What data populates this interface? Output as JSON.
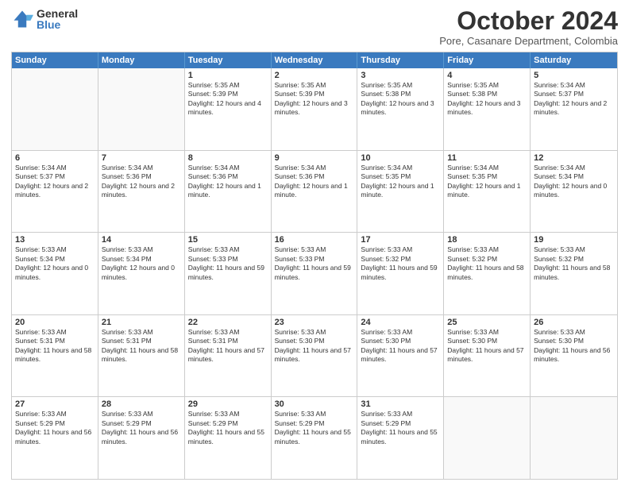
{
  "logo": {
    "general": "General",
    "blue": "Blue"
  },
  "header": {
    "month": "October 2024",
    "location": "Pore, Casanare Department, Colombia"
  },
  "days": [
    "Sunday",
    "Monday",
    "Tuesday",
    "Wednesday",
    "Thursday",
    "Friday",
    "Saturday"
  ],
  "rows": [
    [
      {
        "day": "",
        "empty": true
      },
      {
        "day": "",
        "empty": true
      },
      {
        "day": "1",
        "sunrise": "Sunrise: 5:35 AM",
        "sunset": "Sunset: 5:39 PM",
        "daylight": "Daylight: 12 hours and 4 minutes."
      },
      {
        "day": "2",
        "sunrise": "Sunrise: 5:35 AM",
        "sunset": "Sunset: 5:39 PM",
        "daylight": "Daylight: 12 hours and 3 minutes."
      },
      {
        "day": "3",
        "sunrise": "Sunrise: 5:35 AM",
        "sunset": "Sunset: 5:38 PM",
        "daylight": "Daylight: 12 hours and 3 minutes."
      },
      {
        "day": "4",
        "sunrise": "Sunrise: 5:35 AM",
        "sunset": "Sunset: 5:38 PM",
        "daylight": "Daylight: 12 hours and 3 minutes."
      },
      {
        "day": "5",
        "sunrise": "Sunrise: 5:34 AM",
        "sunset": "Sunset: 5:37 PM",
        "daylight": "Daylight: 12 hours and 2 minutes."
      }
    ],
    [
      {
        "day": "6",
        "sunrise": "Sunrise: 5:34 AM",
        "sunset": "Sunset: 5:37 PM",
        "daylight": "Daylight: 12 hours and 2 minutes."
      },
      {
        "day": "7",
        "sunrise": "Sunrise: 5:34 AM",
        "sunset": "Sunset: 5:36 PM",
        "daylight": "Daylight: 12 hours and 2 minutes."
      },
      {
        "day": "8",
        "sunrise": "Sunrise: 5:34 AM",
        "sunset": "Sunset: 5:36 PM",
        "daylight": "Daylight: 12 hours and 1 minute."
      },
      {
        "day": "9",
        "sunrise": "Sunrise: 5:34 AM",
        "sunset": "Sunset: 5:36 PM",
        "daylight": "Daylight: 12 hours and 1 minute."
      },
      {
        "day": "10",
        "sunrise": "Sunrise: 5:34 AM",
        "sunset": "Sunset: 5:35 PM",
        "daylight": "Daylight: 12 hours and 1 minute."
      },
      {
        "day": "11",
        "sunrise": "Sunrise: 5:34 AM",
        "sunset": "Sunset: 5:35 PM",
        "daylight": "Daylight: 12 hours and 1 minute."
      },
      {
        "day": "12",
        "sunrise": "Sunrise: 5:34 AM",
        "sunset": "Sunset: 5:34 PM",
        "daylight": "Daylight: 12 hours and 0 minutes."
      }
    ],
    [
      {
        "day": "13",
        "sunrise": "Sunrise: 5:33 AM",
        "sunset": "Sunset: 5:34 PM",
        "daylight": "Daylight: 12 hours and 0 minutes."
      },
      {
        "day": "14",
        "sunrise": "Sunrise: 5:33 AM",
        "sunset": "Sunset: 5:34 PM",
        "daylight": "Daylight: 12 hours and 0 minutes."
      },
      {
        "day": "15",
        "sunrise": "Sunrise: 5:33 AM",
        "sunset": "Sunset: 5:33 PM",
        "daylight": "Daylight: 11 hours and 59 minutes."
      },
      {
        "day": "16",
        "sunrise": "Sunrise: 5:33 AM",
        "sunset": "Sunset: 5:33 PM",
        "daylight": "Daylight: 11 hours and 59 minutes."
      },
      {
        "day": "17",
        "sunrise": "Sunrise: 5:33 AM",
        "sunset": "Sunset: 5:32 PM",
        "daylight": "Daylight: 11 hours and 59 minutes."
      },
      {
        "day": "18",
        "sunrise": "Sunrise: 5:33 AM",
        "sunset": "Sunset: 5:32 PM",
        "daylight": "Daylight: 11 hours and 58 minutes."
      },
      {
        "day": "19",
        "sunrise": "Sunrise: 5:33 AM",
        "sunset": "Sunset: 5:32 PM",
        "daylight": "Daylight: 11 hours and 58 minutes."
      }
    ],
    [
      {
        "day": "20",
        "sunrise": "Sunrise: 5:33 AM",
        "sunset": "Sunset: 5:31 PM",
        "daylight": "Daylight: 11 hours and 58 minutes."
      },
      {
        "day": "21",
        "sunrise": "Sunrise: 5:33 AM",
        "sunset": "Sunset: 5:31 PM",
        "daylight": "Daylight: 11 hours and 58 minutes."
      },
      {
        "day": "22",
        "sunrise": "Sunrise: 5:33 AM",
        "sunset": "Sunset: 5:31 PM",
        "daylight": "Daylight: 11 hours and 57 minutes."
      },
      {
        "day": "23",
        "sunrise": "Sunrise: 5:33 AM",
        "sunset": "Sunset: 5:30 PM",
        "daylight": "Daylight: 11 hours and 57 minutes."
      },
      {
        "day": "24",
        "sunrise": "Sunrise: 5:33 AM",
        "sunset": "Sunset: 5:30 PM",
        "daylight": "Daylight: 11 hours and 57 minutes."
      },
      {
        "day": "25",
        "sunrise": "Sunrise: 5:33 AM",
        "sunset": "Sunset: 5:30 PM",
        "daylight": "Daylight: 11 hours and 57 minutes."
      },
      {
        "day": "26",
        "sunrise": "Sunrise: 5:33 AM",
        "sunset": "Sunset: 5:30 PM",
        "daylight": "Daylight: 11 hours and 56 minutes."
      }
    ],
    [
      {
        "day": "27",
        "sunrise": "Sunrise: 5:33 AM",
        "sunset": "Sunset: 5:29 PM",
        "daylight": "Daylight: 11 hours and 56 minutes."
      },
      {
        "day": "28",
        "sunrise": "Sunrise: 5:33 AM",
        "sunset": "Sunset: 5:29 PM",
        "daylight": "Daylight: 11 hours and 56 minutes."
      },
      {
        "day": "29",
        "sunrise": "Sunrise: 5:33 AM",
        "sunset": "Sunset: 5:29 PM",
        "daylight": "Daylight: 11 hours and 55 minutes."
      },
      {
        "day": "30",
        "sunrise": "Sunrise: 5:33 AM",
        "sunset": "Sunset: 5:29 PM",
        "daylight": "Daylight: 11 hours and 55 minutes."
      },
      {
        "day": "31",
        "sunrise": "Sunrise: 5:33 AM",
        "sunset": "Sunset: 5:29 PM",
        "daylight": "Daylight: 11 hours and 55 minutes."
      },
      {
        "day": "",
        "empty": true
      },
      {
        "day": "",
        "empty": true
      }
    ]
  ]
}
